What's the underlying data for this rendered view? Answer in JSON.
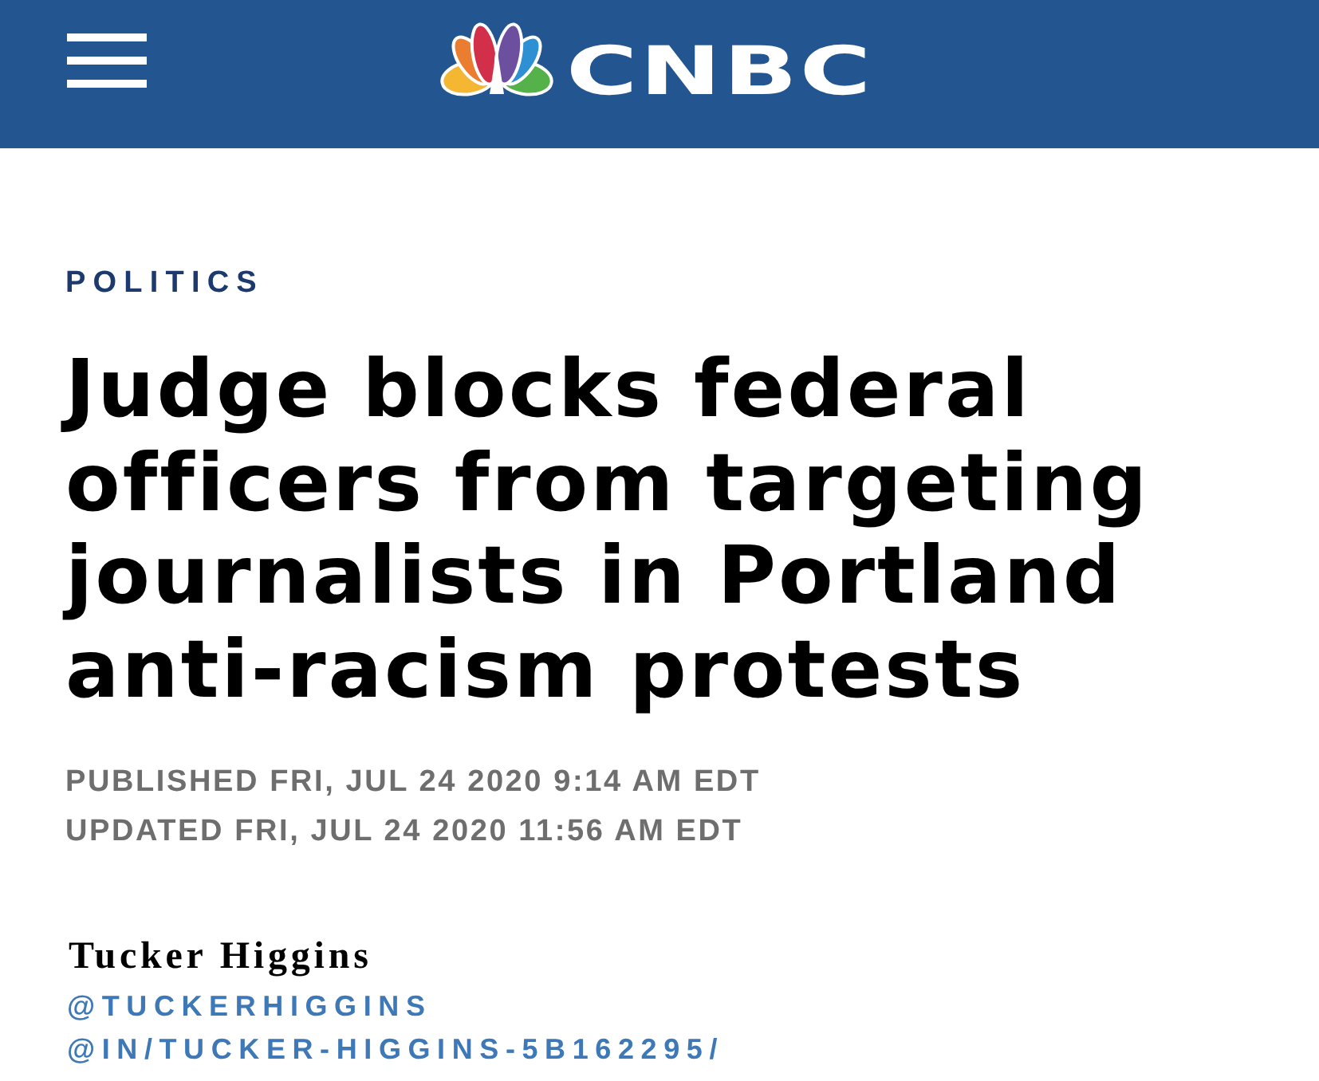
{
  "header": {
    "logo_text": "CNBC"
  },
  "article": {
    "section": "POLITICS",
    "headline": "Judge blocks federal officers from targeting journalists in Portland anti-racism protests",
    "published": "PUBLISHED FRI, JUL 24 2020 9:14 AM EDT",
    "updated": "UPDATED FRI, JUL 24 2020 11:56 AM EDT"
  },
  "author": {
    "name": "Tucker Higgins",
    "handles": [
      "@TUCKERHIGGINS",
      "@IN/TUCKER-HIGGINS-5B162295/"
    ]
  }
}
